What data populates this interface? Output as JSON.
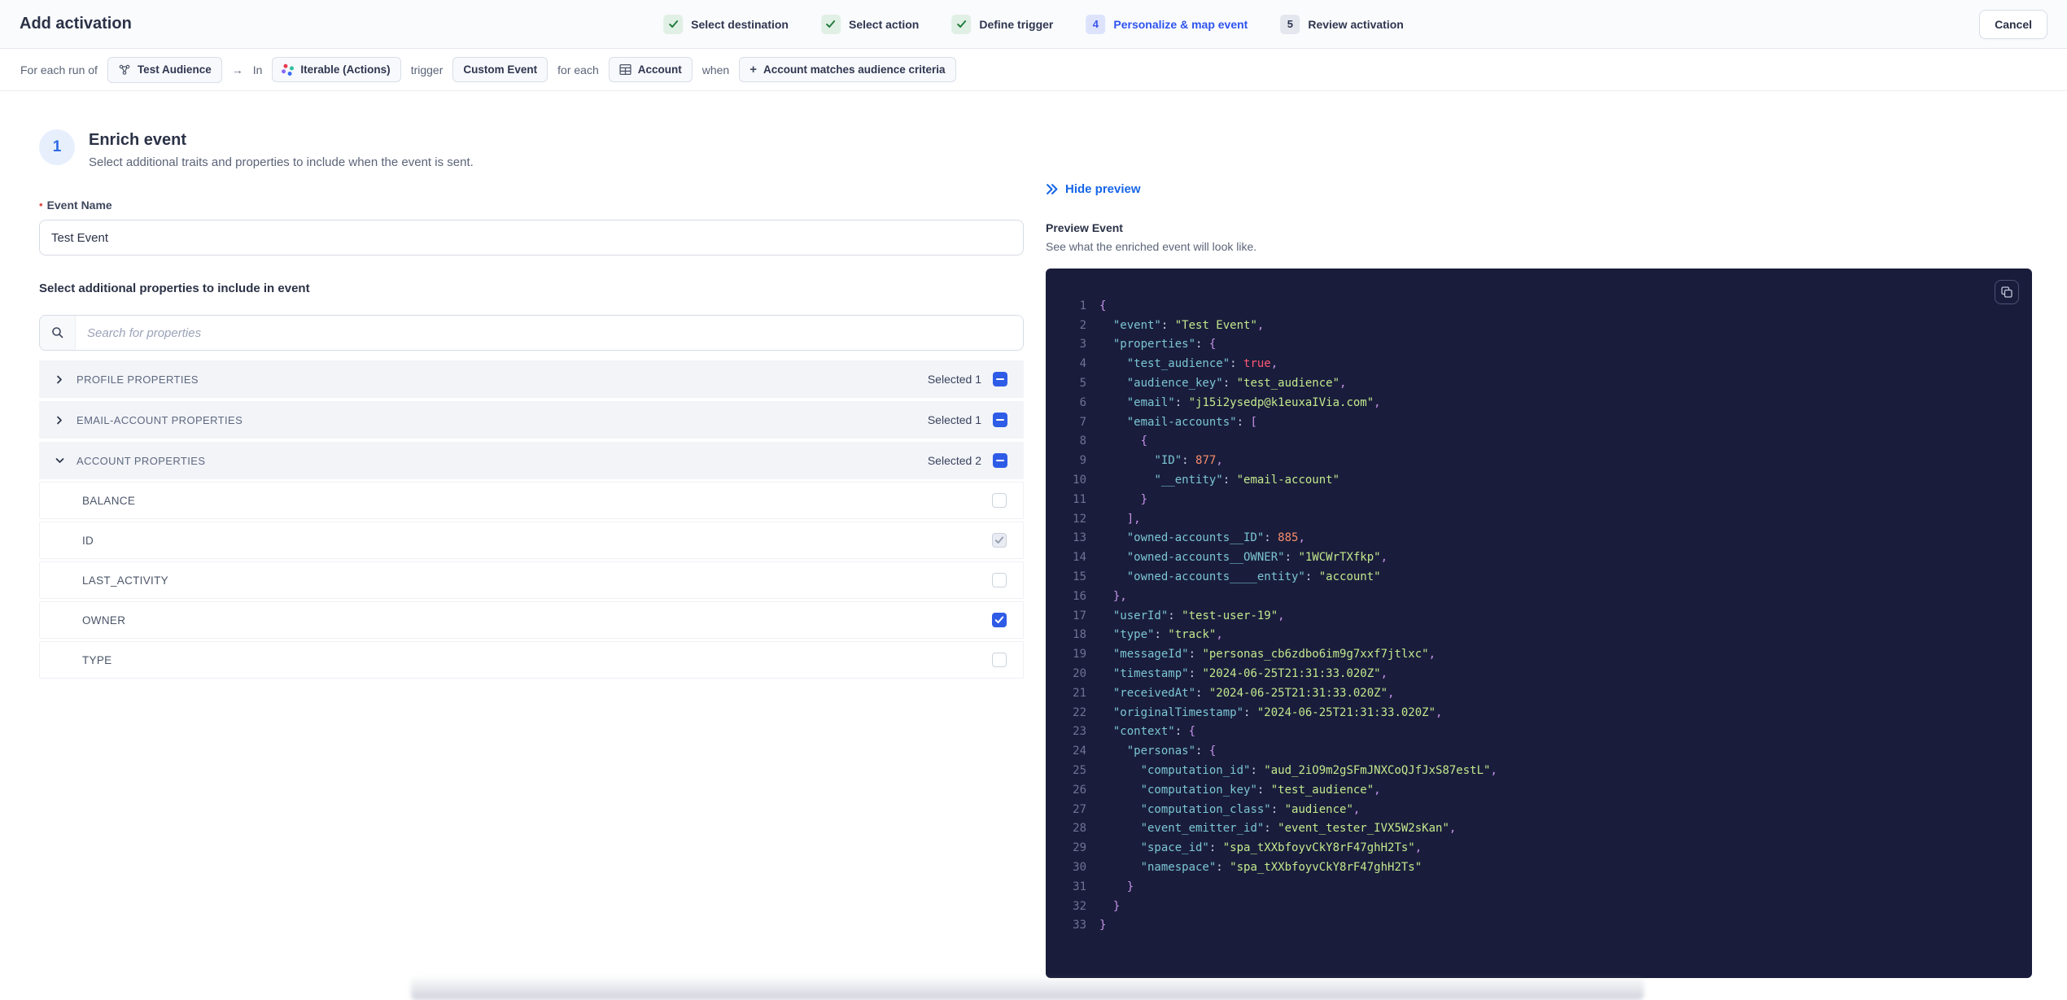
{
  "header": {
    "title": "Add activation",
    "cancel_label": "Cancel",
    "steps": [
      {
        "label": "Select destination",
        "state": "done",
        "number": null
      },
      {
        "label": "Select action",
        "state": "done",
        "number": null
      },
      {
        "label": "Define trigger",
        "state": "done",
        "number": null
      },
      {
        "label": "Personalize & map event",
        "state": "active",
        "number": "4"
      },
      {
        "label": "Review activation",
        "state": "upcoming",
        "number": "5"
      }
    ]
  },
  "trigger_bar": {
    "tokens": [
      {
        "type": "text",
        "text": "For each run of"
      },
      {
        "type": "chip",
        "icon": "audience-icon",
        "label": "Test Audience"
      },
      {
        "type": "text",
        "text": "→"
      },
      {
        "type": "text",
        "text": "In"
      },
      {
        "type": "chip",
        "icon": "iterable-icon",
        "label": "Iterable (Actions)"
      },
      {
        "type": "text",
        "text": "trigger"
      },
      {
        "type": "chip",
        "icon": null,
        "label": "Custom Event"
      },
      {
        "type": "text",
        "text": "for each"
      },
      {
        "type": "chip",
        "icon": "table-icon",
        "label": "Account"
      },
      {
        "type": "text",
        "text": "when"
      },
      {
        "type": "chip",
        "icon": "plus-icon",
        "label": "Account matches audience criteria"
      }
    ]
  },
  "enrich": {
    "step_number": "1",
    "title": "Enrich event",
    "subtitle": "Select additional traits and properties to include when the event is sent.",
    "event_name_label": "Event Name",
    "event_name_value": "Test Event",
    "properties_label": "Select additional properties to include in event",
    "search_placeholder": "Search for properties",
    "groups": [
      {
        "label": "PROFILE PROPERTIES",
        "selected_text": "Selected 1",
        "expanded": false,
        "properties": []
      },
      {
        "label": "EMAIL-ACCOUNT PROPERTIES",
        "selected_text": "Selected 1",
        "expanded": false,
        "properties": []
      },
      {
        "label": "ACCOUNT PROPERTIES",
        "selected_text": "Selected 2",
        "expanded": true,
        "properties": [
          {
            "name": "BALANCE",
            "state": "empty"
          },
          {
            "name": "ID",
            "state": "checked-disabled"
          },
          {
            "name": "LAST_ACTIVITY",
            "state": "empty"
          },
          {
            "name": "OWNER",
            "state": "checked"
          },
          {
            "name": "TYPE",
            "state": "empty"
          }
        ]
      }
    ]
  },
  "preview": {
    "hide_label": "Hide preview",
    "title": "Preview Event",
    "subtitle": "See what the enriched event will look like.",
    "code_lines": [
      [
        [
          "pnc",
          "{"
        ]
      ],
      [
        [
          "pln",
          "  "
        ],
        [
          "key",
          "\"event\""
        ],
        [
          "pln",
          ": "
        ],
        [
          "str",
          "\"Test Event\""
        ],
        [
          "pnc",
          ","
        ]
      ],
      [
        [
          "pln",
          "  "
        ],
        [
          "key",
          "\"properties\""
        ],
        [
          "pln",
          ": "
        ],
        [
          "pnc",
          "{"
        ]
      ],
      [
        [
          "pln",
          "    "
        ],
        [
          "key",
          "\"test_audience\""
        ],
        [
          "pln",
          ": "
        ],
        [
          "bool",
          "true"
        ],
        [
          "pnc",
          ","
        ]
      ],
      [
        [
          "pln",
          "    "
        ],
        [
          "key",
          "\"audience_key\""
        ],
        [
          "pln",
          ": "
        ],
        [
          "str",
          "\"test_audience\""
        ],
        [
          "pnc",
          ","
        ]
      ],
      [
        [
          "pln",
          "    "
        ],
        [
          "key",
          "\"email\""
        ],
        [
          "pln",
          ": "
        ],
        [
          "str",
          "\"j15i2ysedp@k1euxaIVia.com\""
        ],
        [
          "pnc",
          ","
        ]
      ],
      [
        [
          "pln",
          "    "
        ],
        [
          "key",
          "\"email-accounts\""
        ],
        [
          "pln",
          ": "
        ],
        [
          "pnc",
          "["
        ]
      ],
      [
        [
          "pln",
          "      "
        ],
        [
          "pnc",
          "{"
        ]
      ],
      [
        [
          "pln",
          "        "
        ],
        [
          "key",
          "\"ID\""
        ],
        [
          "pln",
          ": "
        ],
        [
          "num",
          "877"
        ],
        [
          "pnc",
          ","
        ]
      ],
      [
        [
          "pln",
          "        "
        ],
        [
          "key",
          "\"__entity\""
        ],
        [
          "pln",
          ": "
        ],
        [
          "str",
          "\"email-account\""
        ]
      ],
      [
        [
          "pln",
          "      "
        ],
        [
          "pnc",
          "}"
        ]
      ],
      [
        [
          "pln",
          "    "
        ],
        [
          "pnc",
          "],"
        ]
      ],
      [
        [
          "pln",
          "    "
        ],
        [
          "key",
          "\"owned-accounts__ID\""
        ],
        [
          "pln",
          ": "
        ],
        [
          "num",
          "885"
        ],
        [
          "pnc",
          ","
        ]
      ],
      [
        [
          "pln",
          "    "
        ],
        [
          "key",
          "\"owned-accounts__OWNER\""
        ],
        [
          "pln",
          ": "
        ],
        [
          "str",
          "\"1WCWrTXfkp\""
        ],
        [
          "pnc",
          ","
        ]
      ],
      [
        [
          "pln",
          "    "
        ],
        [
          "key",
          "\"owned-accounts____entity\""
        ],
        [
          "pln",
          ": "
        ],
        [
          "str",
          "\"account\""
        ]
      ],
      [
        [
          "pln",
          "  "
        ],
        [
          "pnc",
          "},"
        ]
      ],
      [
        [
          "pln",
          "  "
        ],
        [
          "key",
          "\"userId\""
        ],
        [
          "pln",
          ": "
        ],
        [
          "str",
          "\"test-user-19\""
        ],
        [
          "pnc",
          ","
        ]
      ],
      [
        [
          "pln",
          "  "
        ],
        [
          "key",
          "\"type\""
        ],
        [
          "pln",
          ": "
        ],
        [
          "str",
          "\"track\""
        ],
        [
          "pnc",
          ","
        ]
      ],
      [
        [
          "pln",
          "  "
        ],
        [
          "key",
          "\"messageId\""
        ],
        [
          "pln",
          ": "
        ],
        [
          "str",
          "\"personas_cb6zdbo6im9g7xxf7jtlxc\""
        ],
        [
          "pnc",
          ","
        ]
      ],
      [
        [
          "pln",
          "  "
        ],
        [
          "key",
          "\"timestamp\""
        ],
        [
          "pln",
          ": "
        ],
        [
          "str",
          "\"2024-06-25T21:31:33.020Z\""
        ],
        [
          "pnc",
          ","
        ]
      ],
      [
        [
          "pln",
          "  "
        ],
        [
          "key",
          "\"receivedAt\""
        ],
        [
          "pln",
          ": "
        ],
        [
          "str",
          "\"2024-06-25T21:31:33.020Z\""
        ],
        [
          "pnc",
          ","
        ]
      ],
      [
        [
          "pln",
          "  "
        ],
        [
          "key",
          "\"originalTimestamp\""
        ],
        [
          "pln",
          ": "
        ],
        [
          "str",
          "\"2024-06-25T21:31:33.020Z\""
        ],
        [
          "pnc",
          ","
        ]
      ],
      [
        [
          "pln",
          "  "
        ],
        [
          "key",
          "\"context\""
        ],
        [
          "pln",
          ": "
        ],
        [
          "pnc",
          "{"
        ]
      ],
      [
        [
          "pln",
          "    "
        ],
        [
          "key",
          "\"personas\""
        ],
        [
          "pln",
          ": "
        ],
        [
          "pnc",
          "{"
        ]
      ],
      [
        [
          "pln",
          "      "
        ],
        [
          "key",
          "\"computation_id\""
        ],
        [
          "pln",
          ": "
        ],
        [
          "str",
          "\"aud_2iO9m2gSFmJNXCoQJfJxS87estL\""
        ],
        [
          "pnc",
          ","
        ]
      ],
      [
        [
          "pln",
          "      "
        ],
        [
          "key",
          "\"computation_key\""
        ],
        [
          "pln",
          ": "
        ],
        [
          "str",
          "\"test_audience\""
        ],
        [
          "pnc",
          ","
        ]
      ],
      [
        [
          "pln",
          "      "
        ],
        [
          "key",
          "\"computation_class\""
        ],
        [
          "pln",
          ": "
        ],
        [
          "str",
          "\"audience\""
        ],
        [
          "pnc",
          ","
        ]
      ],
      [
        [
          "pln",
          "      "
        ],
        [
          "key",
          "\"event_emitter_id\""
        ],
        [
          "pln",
          ": "
        ],
        [
          "str",
          "\"event_tester_IVX5W2sKan\""
        ],
        [
          "pnc",
          ","
        ]
      ],
      [
        [
          "pln",
          "      "
        ],
        [
          "key",
          "\"space_id\""
        ],
        [
          "pln",
          ": "
        ],
        [
          "str",
          "\"spa_tXXbfoyvCkY8rF47ghH2Ts\""
        ],
        [
          "pnc",
          ","
        ]
      ],
      [
        [
          "pln",
          "      "
        ],
        [
          "key",
          "\"namespace\""
        ],
        [
          "pln",
          ": "
        ],
        [
          "str",
          "\"spa_tXXbfoyvCkY8rF47ghH2Ts\""
        ]
      ],
      [
        [
          "pln",
          "    "
        ],
        [
          "pnc",
          "}"
        ]
      ],
      [
        [
          "pln",
          "  "
        ],
        [
          "pnc",
          "}"
        ]
      ],
      [
        [
          "pnc",
          "}"
        ]
      ]
    ]
  },
  "colors": {
    "accent_blue": "#2e53ef",
    "link_blue": "#1565e8",
    "checkbox_blue": "#2f5ce6",
    "step_done_green": "#237d3f",
    "code_background": "#191d3b",
    "code_key": "#7cc5d4",
    "code_string": "#c3e88d",
    "code_number": "#f78c6c",
    "code_boolean": "#ff5874",
    "code_punctuation": "#c792ea"
  }
}
